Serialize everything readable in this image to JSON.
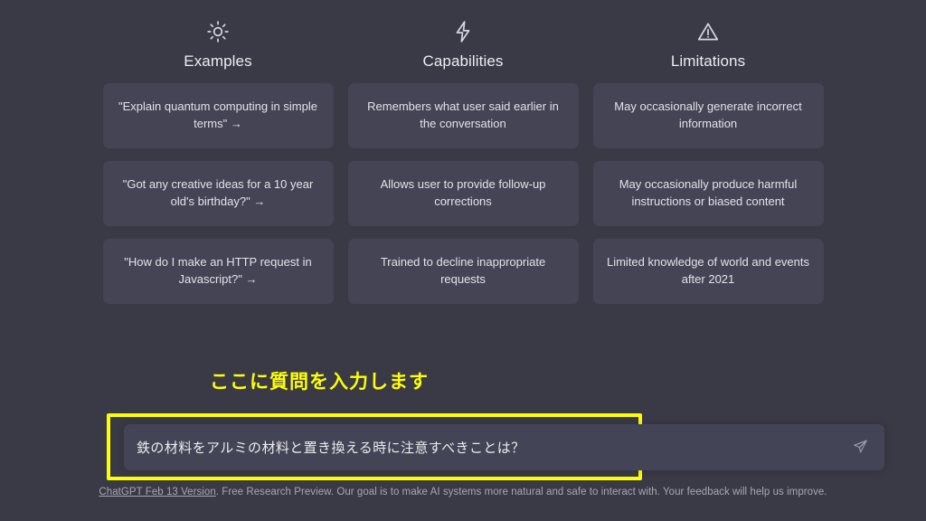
{
  "theme": {
    "background": "#3a3a47",
    "card_background": "#444455",
    "text": "#ececf1",
    "muted_text": "#a7a7b4",
    "highlight": "#ffff00"
  },
  "columns": [
    {
      "icon": "sun-icon",
      "title": "Examples",
      "cards": [
        "\"Explain quantum computing in simple terms\" →",
        "\"Got any creative ideas for a 10 year old's birthday?\" →",
        "\"How do I make an HTTP request in Javascript?\" →"
      ]
    },
    {
      "icon": "lightning-bolt-icon",
      "title": "Capabilities",
      "cards": [
        "Remembers what user said earlier in the conversation",
        "Allows user to provide follow-up corrections",
        "Trained to decline inappropriate requests"
      ]
    },
    {
      "icon": "warning-triangle-icon",
      "title": "Limitations",
      "cards": [
        "May occasionally generate incorrect information",
        "May occasionally produce harmful instructions or biased content",
        "Limited knowledge of world and events after 2021"
      ]
    }
  ],
  "annotation": {
    "text": "ここに質問を入力します"
  },
  "composer": {
    "value": "鉄の材料をアルミの材料と置き換える時に注意すべきことは？",
    "placeholder": "",
    "send_icon": "send-paper-plane-icon"
  },
  "footer": {
    "link_text": "ChatGPT Feb 13 Version",
    "rest_text": ". Free Research Preview. Our goal is to make AI systems more natural and safe to interact with. Your feedback will help us improve."
  }
}
